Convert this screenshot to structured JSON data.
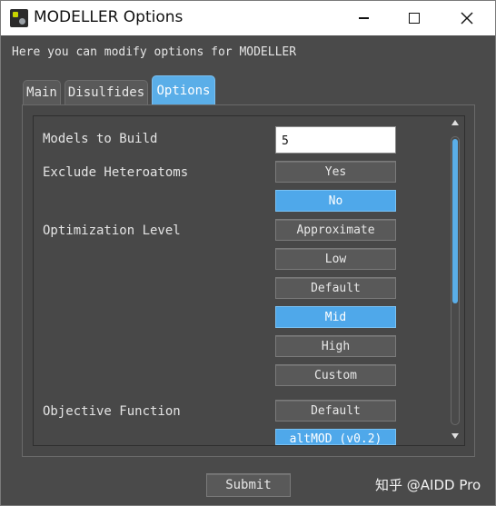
{
  "window": {
    "title": "MODELLER Options",
    "controls": {
      "minimize": "minimize-icon",
      "maximize": "maximize-icon",
      "close": "close-icon"
    }
  },
  "intro_text": "Here you can modify options for MODELLER",
  "tabs": [
    {
      "label": "Main",
      "active": false
    },
    {
      "label": "Disulfides",
      "active": false
    },
    {
      "label": "Options",
      "active": true
    }
  ],
  "options": {
    "models_to_build": {
      "label": "Models to Build",
      "value": "5"
    },
    "exclude_heteroatoms": {
      "label": "Exclude Heteroatoms",
      "choices": [
        "Yes",
        "No"
      ],
      "selected": "No"
    },
    "optimization_level": {
      "label": "Optimization Level",
      "choices": [
        "Approximate",
        "Low",
        "Default",
        "Mid",
        "High",
        "Custom"
      ],
      "selected": "Mid"
    },
    "objective_function": {
      "label": "Objective Function",
      "choices": [
        "Default",
        "altMOD (v0.2)"
      ],
      "selected": "altMOD (v0.2)"
    }
  },
  "scrollbar": {
    "position_fraction": 0.0,
    "visible_fraction": 0.57
  },
  "submit_label": "Submit",
  "watermark": "知乎 @AIDD Pro",
  "colors": {
    "accent": "#4fa8ea",
    "background": "#4a4a4a",
    "button": "#595959",
    "text": "#e4e4e4"
  }
}
